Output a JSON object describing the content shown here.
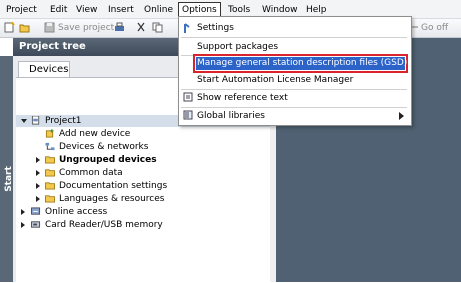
{
  "menubar": {
    "items": [
      "Project",
      "Edit",
      "View",
      "Insert",
      "Online",
      "Options",
      "Tools",
      "Window",
      "Help"
    ],
    "open_item": "Options"
  },
  "toolbar": {
    "save_label": "Save project",
    "go_offline_label": "Go off"
  },
  "project_tree": {
    "header": "Project tree",
    "side_label": "Start",
    "tab": "Devices",
    "items": [
      {
        "label": "Project1",
        "expanded": true,
        "selected": true
      },
      {
        "label": "Add new device"
      },
      {
        "label": "Devices & networks"
      },
      {
        "label": "Ungrouped devices",
        "bold": true
      },
      {
        "label": "Common data"
      },
      {
        "label": "Documentation settings"
      },
      {
        "label": "Languages & resources"
      },
      {
        "label": "Online access"
      },
      {
        "label": "Card Reader/USB memory"
      }
    ]
  },
  "options_menu": {
    "items": [
      {
        "label": "Settings"
      },
      {
        "label": "Support packages"
      },
      {
        "label": "Manage general station description files (GSD)",
        "highlighted": true
      },
      {
        "label": "Start Automation License Manager"
      },
      {
        "label": "Show reference text"
      },
      {
        "label": "Global libraries",
        "has_submenu": true
      }
    ]
  },
  "colors": {
    "highlight": "#2b63c9",
    "highlight_border": "#d9232d",
    "tree_header": "#4a5666",
    "work_area": "#4f6172"
  }
}
